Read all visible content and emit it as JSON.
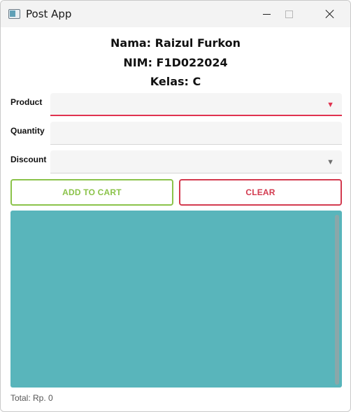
{
  "window": {
    "title": "Post App"
  },
  "header": {
    "nama": "Nama: Raizul Furkon",
    "nim": "NIM: F1D022024",
    "kelas": "Kelas: C"
  },
  "form": {
    "product": {
      "label": "Product",
      "value": "",
      "arrow": "▼"
    },
    "quantity": {
      "label": "Quantity",
      "value": ""
    },
    "discount": {
      "label": "Discount",
      "value": "",
      "arrow": "▼"
    }
  },
  "buttons": {
    "add_to_cart": "ADD TO CART",
    "clear": "CLEAR"
  },
  "footer": {
    "total": "Total: Rp. 0"
  },
  "colors": {
    "accent_red": "#e0324f",
    "add_green": "#8bc34a",
    "cart_teal": "#59b5bb"
  }
}
